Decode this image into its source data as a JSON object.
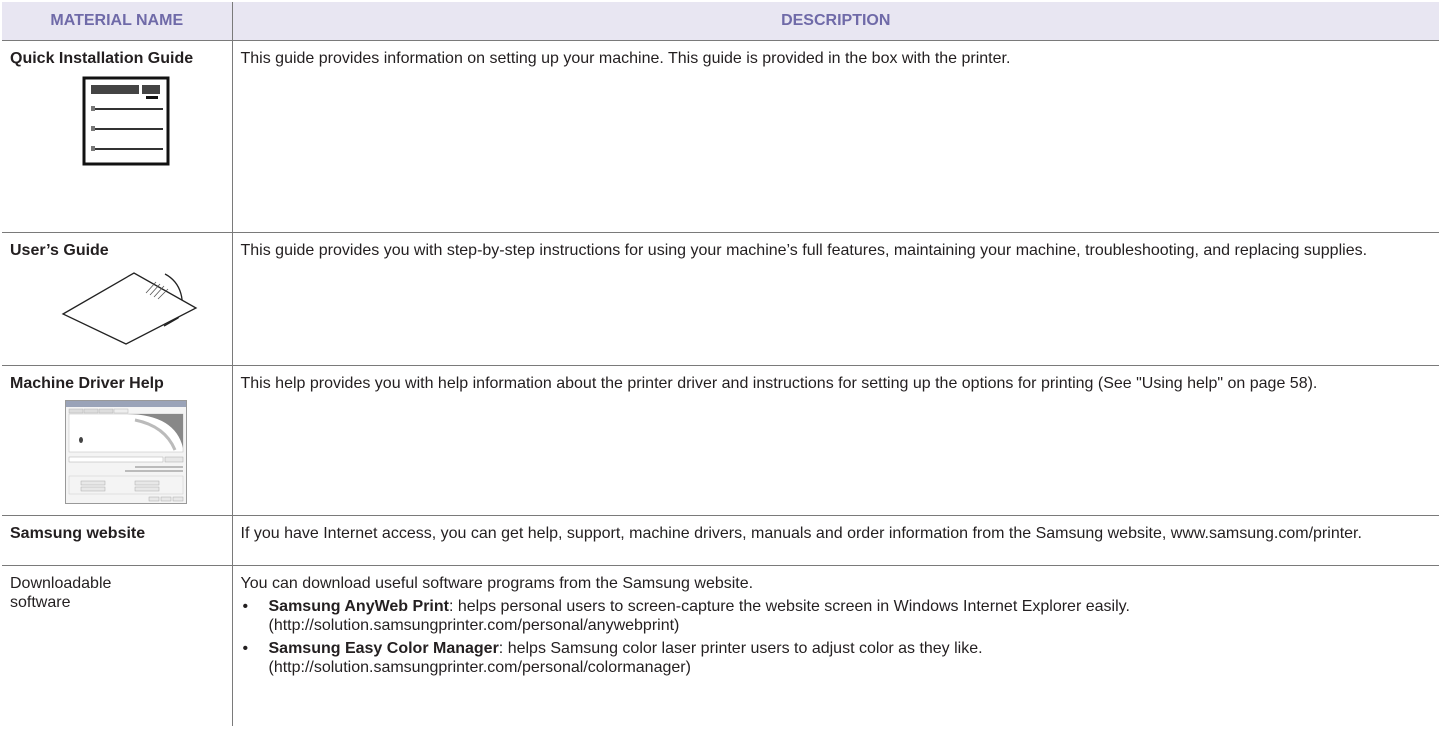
{
  "table": {
    "headers": {
      "material": "MATERIAL NAME",
      "description": "DESCRIPTION"
    },
    "rows": [
      {
        "name": "Quick Installation Guide",
        "desc": "This guide provides information on setting up your machine. This guide is provided in the box with the printer.",
        "illustration": "quick-guide-booklet-icon"
      },
      {
        "name": "User’s Guide",
        "desc": "This guide provides you with step-by-step instructions for using your machine’s full features, maintaining your machine, troubleshooting, and replacing supplies.",
        "illustration": "cd-in-sleeve-icon"
      },
      {
        "name": "Machine Driver Help",
        "desc": "This help provides you with help information about the printer driver and instructions for setting up the options for printing (See \"Using help\" on page 58).",
        "illustration": "driver-dialog-screenshot-icon"
      },
      {
        "name": "Samsung website",
        "desc": "If you have Internet access, you can get help, support, machine drivers, manuals and order information from the Samsung website, www.samsung.com/printer."
      },
      {
        "name": "Downloadable software",
        "desc": "You can download useful software programs from the Samsung website.",
        "bullet_symbol": "•",
        "bullets": [
          {
            "title": "Samsung AnyWeb Print",
            "text": ": helps personal users to screen-capture the website screen in Windows Internet Explorer easily.",
            "url": "(http://solution.samsungprinter.com/personal/anywebprint)"
          },
          {
            "title": "Samsung Easy Color Manager",
            "text": ": helps Samsung color laser printer users to adjust color as they like.",
            "url": "(http://solution.samsungprinter.com/personal/colormanager)"
          }
        ]
      }
    ]
  },
  "colors": {
    "header_bg": "#e8e6f2",
    "header_text": "#6f6aa8",
    "rule": "#7a7a7a"
  }
}
